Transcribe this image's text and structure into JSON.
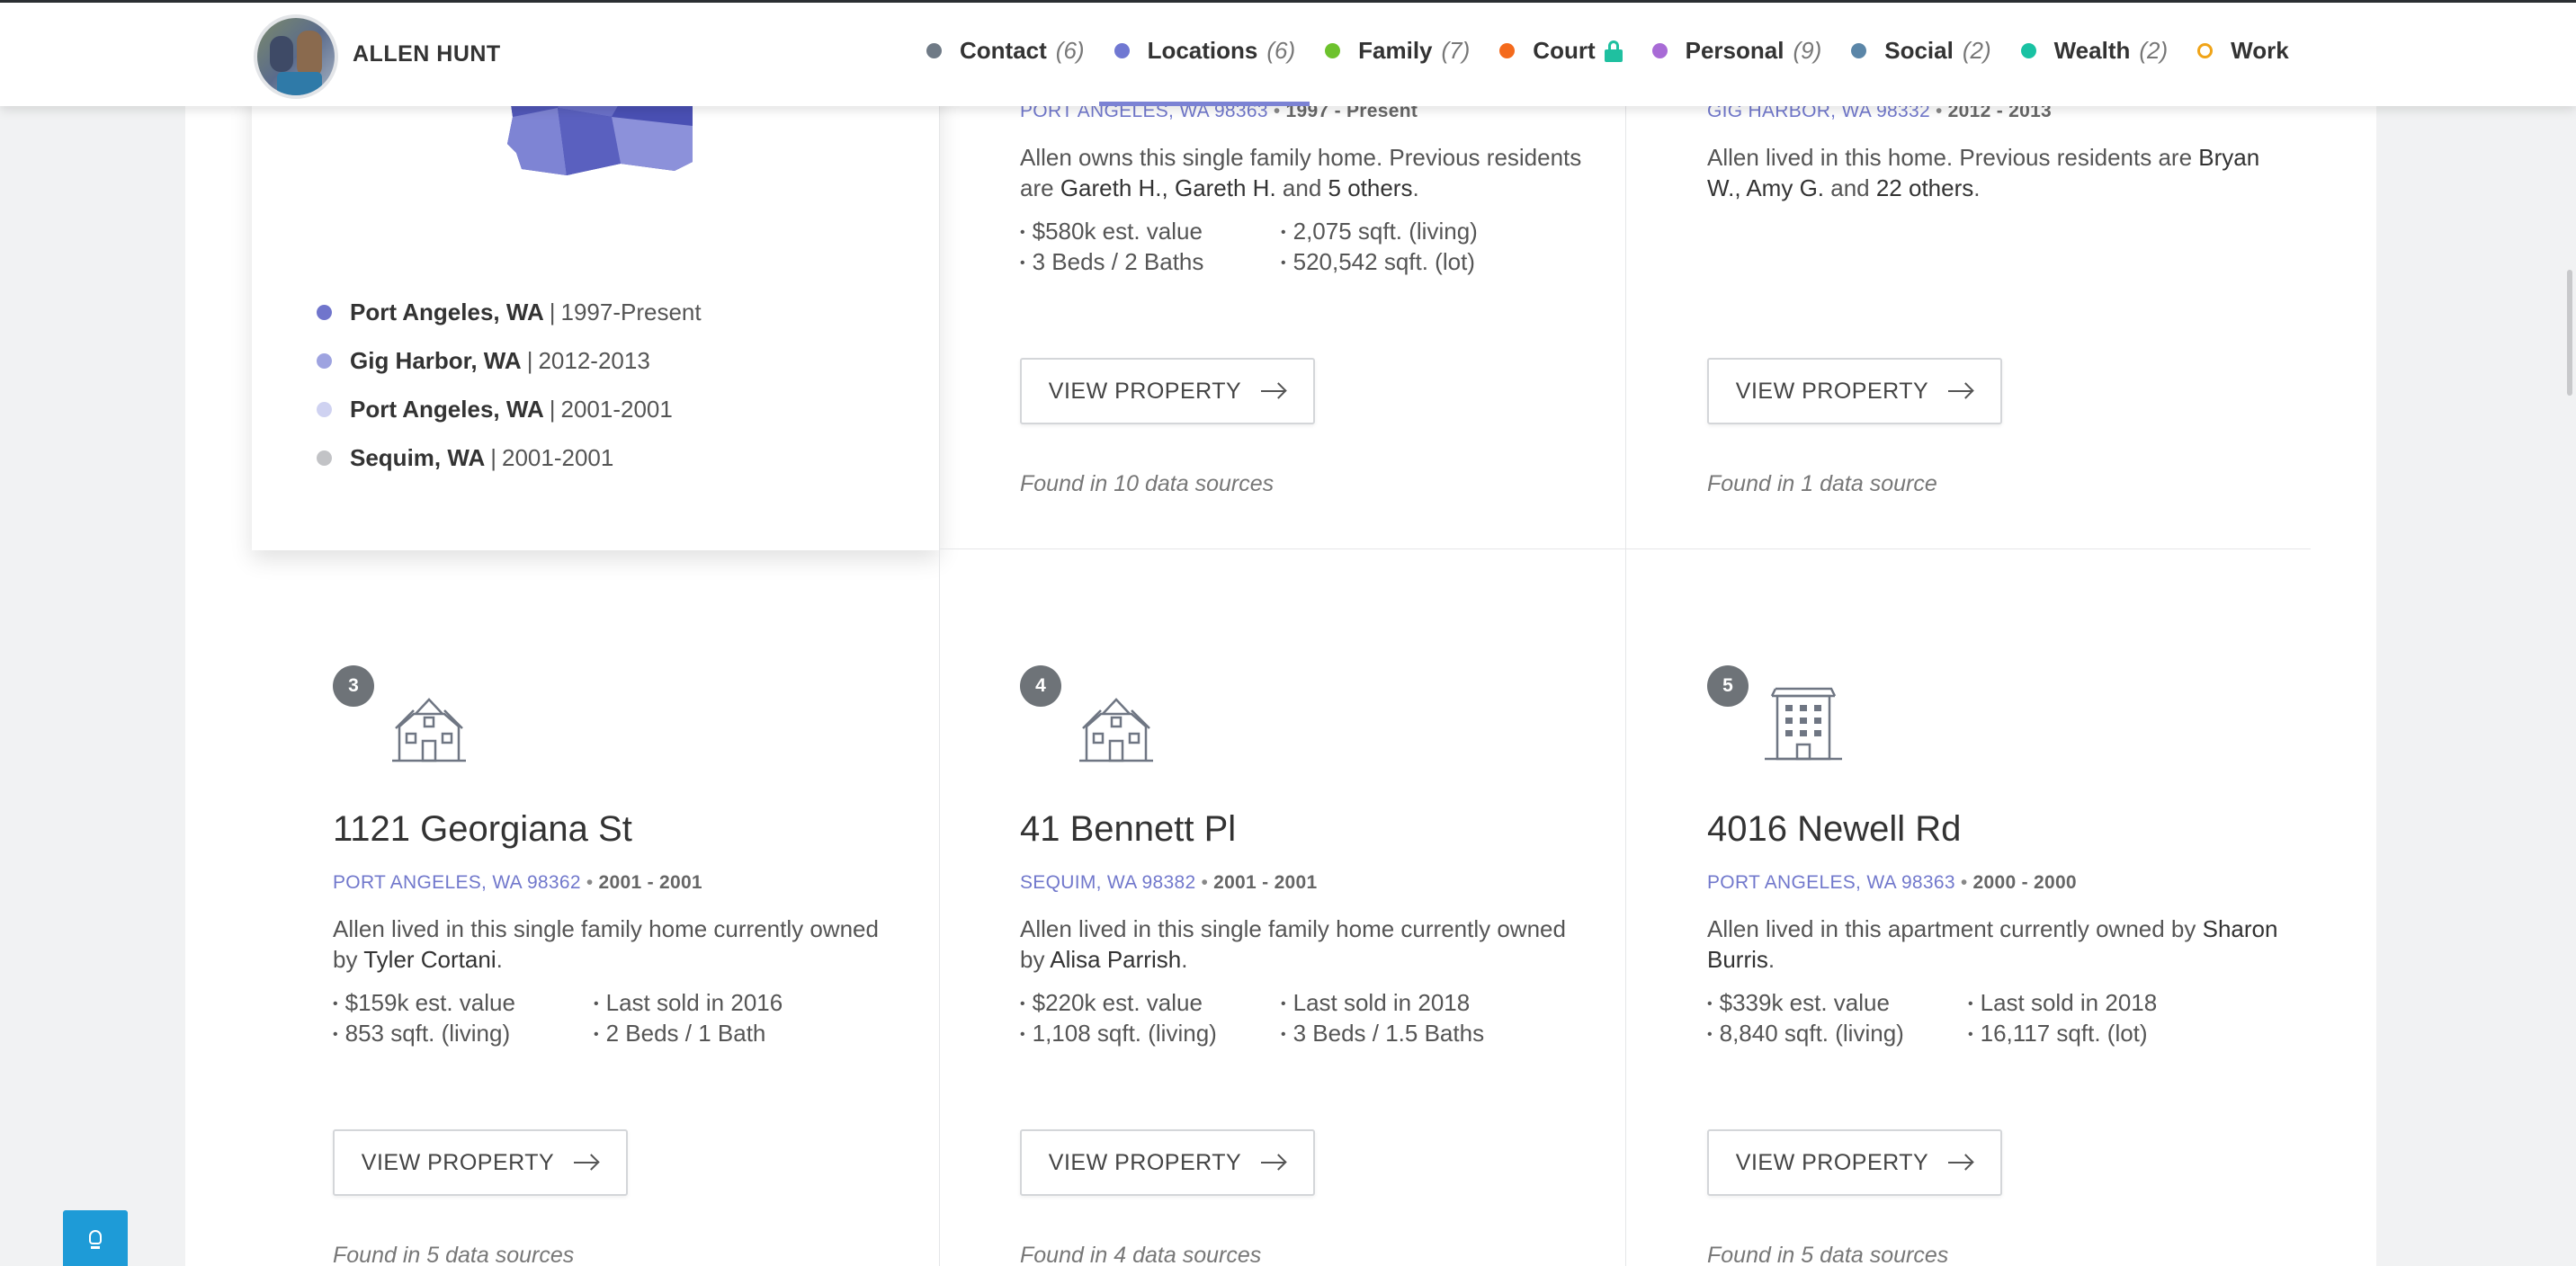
{
  "header": {
    "user_name": "ALLEN HUNT",
    "nav": [
      {
        "label": "Contact",
        "count": "(6)",
        "color": "#6f7a86"
      },
      {
        "label": "Locations",
        "count": "(6)",
        "color": "#7078d2"
      },
      {
        "label": "Family",
        "count": "(7)",
        "color": "#6dc22d"
      },
      {
        "label": "Court",
        "count": "",
        "color": "#f46a1c",
        "locked": true
      },
      {
        "label": "Personal",
        "count": "(9)",
        "color": "#a86bd6"
      },
      {
        "label": "Social",
        "count": "(2)",
        "color": "#5b86a8"
      },
      {
        "label": "Wealth",
        "count": "(2)",
        "color": "#19c2a3"
      },
      {
        "label": "Work",
        "count": "",
        "color": "#f0a418",
        "hollow": true
      }
    ]
  },
  "locations_list": [
    {
      "name": "Port Angeles, WA",
      "years": "1997-Present",
      "color": "#7075cc"
    },
    {
      "name": "Gig Harbor, WA",
      "years": "2012-2013",
      "color": "#9ea3e0"
    },
    {
      "name": "Port Angeles, WA",
      "years": "2001-2001",
      "color": "#cfd2f1"
    },
    {
      "name": "Sequim, WA",
      "years": "2001-2001",
      "color": "#c2c3c6"
    }
  ],
  "top_cards": [
    {
      "city": "PORT ANGELES, WA 98363",
      "years": "1997 - Present",
      "desc_a": "Allen owns this single family home. Previous residents are ",
      "desc_names": "Gareth H., Gareth H.",
      "desc_b": " and ",
      "desc_names2": "5 others",
      "desc_c": ".",
      "facts": [
        "$580k est. value",
        "2,075 sqft. (living)",
        "3 Beds / 2 Baths",
        "520,542 sqft. (lot)"
      ],
      "button": "VIEW PROPERTY",
      "sources": "Found in 10 data sources"
    },
    {
      "city": "GIG HARBOR, WA 98332",
      "years": "2012 - 2013",
      "desc_a": "Allen lived in this home. Previous residents are ",
      "desc_names": "Bryan W., Amy G.",
      "desc_b": " and ",
      "desc_names2": "22 others",
      "desc_c": ".",
      "facts": [],
      "button": "VIEW PROPERTY",
      "sources": "Found in 1 data source"
    }
  ],
  "bottom_cards": [
    {
      "badge": "3",
      "icon": "house-icon",
      "address": "1121 Georgiana St",
      "city": "PORT ANGELES, WA 98362",
      "years": "2001 - 2001",
      "desc_a": "Allen lived in this single family home currently owned by ",
      "desc_names": "Tyler Cortani",
      "desc_c": ".",
      "facts": [
        "$159k est. value",
        "Last sold in 2016",
        "853 sqft. (living)",
        "2 Beds / 1 Bath"
      ],
      "button": "VIEW PROPERTY",
      "sources": "Found in 5 data sources"
    },
    {
      "badge": "4",
      "icon": "house-icon",
      "address": "41 Bennett Pl",
      "city": "SEQUIM, WA 98382",
      "years": "2001 - 2001",
      "desc_a": "Allen lived in this single family home currently owned by ",
      "desc_names": "Alisa Parrish",
      "desc_c": ".",
      "facts": [
        "$220k est. value",
        "Last sold in 2018",
        "1,108 sqft. (living)",
        "3 Beds / 1.5 Baths"
      ],
      "button": "VIEW PROPERTY",
      "sources": "Found in 4 data sources"
    },
    {
      "badge": "5",
      "icon": "apartment-building-icon",
      "address": "4016 Newell Rd",
      "city": "PORT ANGELES, WA 98363",
      "years": "2000 - 2000",
      "desc_a": "Allen lived in this apartment currently owned by ",
      "desc_names": "Sharon Burris",
      "desc_c": ".",
      "facts": [
        "$339k est. value",
        "Last sold in 2018",
        "8,840 sqft. (living)",
        "16,117 sqft. (lot)"
      ],
      "button": "VIEW PROPERTY",
      "sources": "Found in 5 data sources"
    }
  ],
  "help_button_icon": "lightbulb-icon"
}
